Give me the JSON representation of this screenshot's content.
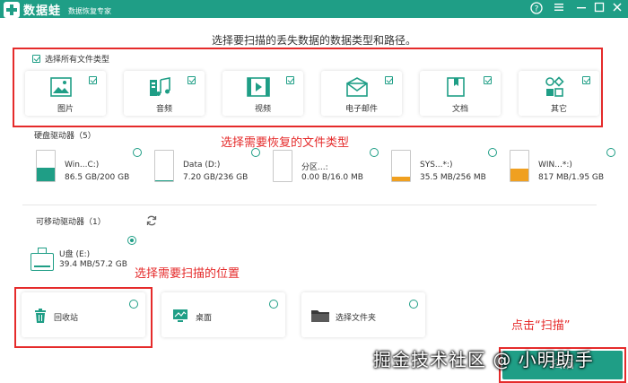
{
  "titlebar": {
    "app_name": "数据蛙",
    "subtitle": "数据恢复专家",
    "help_icon": "help-icon",
    "menu_icon": "menu-icon",
    "minimize_icon": "minimize-icon",
    "maximize_icon": "maximize-icon",
    "close_icon": "close-icon"
  },
  "instruction": "选择要扫描的丢失数据的数据类型和路径。",
  "file_types": {
    "select_all_label": "选择所有文件类型",
    "select_all_checked": true,
    "items": [
      {
        "label": "图片",
        "icon": "image-icon",
        "checked": true
      },
      {
        "label": "音频",
        "icon": "audio-icon",
        "checked": true
      },
      {
        "label": "视频",
        "icon": "video-icon",
        "checked": true
      },
      {
        "label": "电子邮件",
        "icon": "email-icon",
        "checked": true
      },
      {
        "label": "文档",
        "icon": "document-icon",
        "checked": true
      },
      {
        "label": "其它",
        "icon": "other-icon",
        "checked": true
      }
    ]
  },
  "annotations": {
    "file_type": "选择需要恢复的文件类型",
    "location": "选择需要扫描的位置",
    "scan": "点击“扫描”"
  },
  "hard_drives": {
    "title": "硬盘驱动器（5）",
    "items": [
      {
        "name": "Win...C:)",
        "size": "86.5 GB/200 GB",
        "fill_fraction": 0.43,
        "color": "#1f9e86"
      },
      {
        "name": "Data (D:)",
        "size": "7.20 GB/236 GB",
        "fill_fraction": 0.03,
        "color": "#1f9e86"
      },
      {
        "name": "分区...:",
        "size": "0.00  B/16.0 MB",
        "fill_fraction": 0,
        "color": "#1f9e86"
      },
      {
        "name": "SYS...*:)",
        "size": "35.5 MB/256 MB",
        "fill_fraction": 0.14,
        "color": "#f0a020"
      },
      {
        "name": "WIN...*:)",
        "size": "817 MB/1.95 GB",
        "fill_fraction": 0.42,
        "color": "#f0a020"
      }
    ]
  },
  "removable": {
    "title": "可移动驱动器（1）",
    "refresh_icon": "refresh-icon",
    "drive": {
      "name": "U盘 (E:)",
      "size": "39.4 MB/57.2 GB",
      "selected": true,
      "fill_fraction": 0.001
    }
  },
  "locations": [
    {
      "label": "回收站",
      "icon": "recycle-bin-icon"
    },
    {
      "label": "桌面",
      "icon": "desktop-icon"
    },
    {
      "label": "选择文件夹",
      "icon": "folder-icon"
    }
  ],
  "scan_button": "扫描",
  "watermark": "掘金技术社区 @ 小明助手",
  "colors": {
    "accent": "#1f9e86",
    "annotation": "#e52b2b",
    "warning": "#f0a020"
  }
}
